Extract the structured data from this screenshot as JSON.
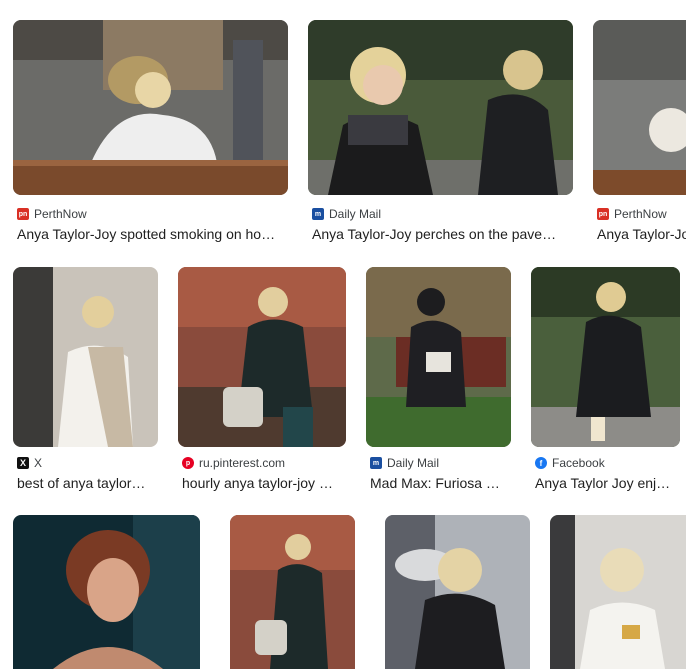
{
  "results": [
    {
      "source": "PerthNow",
      "favicon": "perthnow-icon",
      "title": "Anya Taylor-Joy spotted smoking on ho…"
    },
    {
      "source": "Daily Mail",
      "favicon": "dailymail-icon",
      "title": "Anya Taylor-Joy perches on the pave…"
    },
    {
      "source": "PerthNow",
      "favicon": "perthnow-icon",
      "title": "Anya Taylor-Jo"
    },
    {
      "source": "X",
      "favicon": "x-icon",
      "title": "best of anya taylor…"
    },
    {
      "source": "ru.pinterest.com",
      "favicon": "pinterest-icon",
      "title": "hourly anya taylor-joy …"
    },
    {
      "source": "Daily Mail",
      "favicon": "dailymail-icon",
      "title": "Mad Max: Furiosa …"
    },
    {
      "source": "Facebook",
      "favicon": "facebook-icon",
      "title": "Anya Taylor Joy enj…"
    },
    {
      "favicon": "none"
    },
    {
      "favicon": "none"
    },
    {
      "favicon": "none"
    },
    {
      "favicon": "none"
    }
  ],
  "favicon_glyphs": {
    "perthnow": "pn",
    "dailymail": "m",
    "x": "X",
    "pinterest": "p",
    "facebook": "f"
  },
  "colors": {
    "favicon_perthnow": "#d93025",
    "favicon_dailymail": "#1a4fa0",
    "favicon_pinterest": "#e60023",
    "favicon_facebook": "#1877f2"
  }
}
